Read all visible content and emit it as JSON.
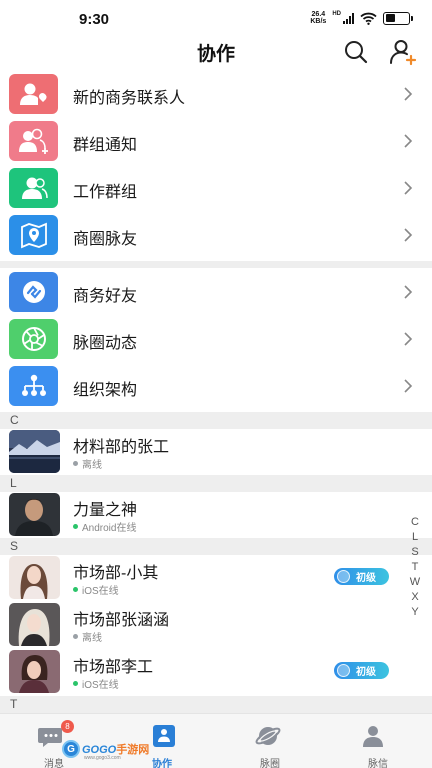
{
  "status_bar": {
    "time": "9:30",
    "net_speed_value": "26.4",
    "net_speed_unit": "KB/s",
    "hd": "HD",
    "battery_level": 0.45
  },
  "nav": {
    "title": "协作",
    "search_icon": "search-icon",
    "add_user_icon": "add-user-icon",
    "accent_plus_color": "#f08a2a"
  },
  "menu_groups": [
    [
      {
        "label": "新的商务联系人",
        "icon": "new-contact-icon",
        "color": "#ee6e73"
      },
      {
        "label": "群组通知",
        "icon": "group-notice-icon",
        "color": "#f07b8a"
      },
      {
        "label": "工作群组",
        "icon": "work-group-icon",
        "color": "#1ec47c"
      },
      {
        "label": "商圈脉友",
        "icon": "location-map-icon",
        "color": "#2b8fe8"
      }
    ],
    [
      {
        "label": "商务好友",
        "icon": "handshake-icon",
        "color": "#3d86e6"
      },
      {
        "label": "脉圈动态",
        "icon": "aperture-icon",
        "color": "#4fcf6c"
      },
      {
        "label": "组织架构",
        "icon": "org-chart-icon",
        "color": "#3b8ff0"
      }
    ]
  ],
  "sections": [
    {
      "letter": "C",
      "contacts": [
        {
          "name": "材料部的张工",
          "status": "离线",
          "status_color": "#9aa0a6",
          "badge": ""
        }
      ]
    },
    {
      "letter": "L",
      "contacts": [
        {
          "name": "力量之神",
          "status": "Android在线",
          "status_color": "#2bc46a",
          "badge": ""
        }
      ]
    },
    {
      "letter": "S",
      "contacts": [
        {
          "name": "市场部-小其",
          "status": "iOS在线",
          "status_color": "#2bc46a",
          "badge": "初级"
        },
        {
          "name": "市场部张涵涵",
          "status": "离线",
          "status_color": "#9aa0a6",
          "badge": ""
        },
        {
          "name": "市场部李工",
          "status": "iOS在线",
          "status_color": "#2bc46a",
          "badge": "初级"
        }
      ]
    },
    {
      "letter": "T",
      "contacts": []
    }
  ],
  "index_letters": [
    "C",
    "L",
    "S",
    "T",
    "W",
    "X",
    "Y"
  ],
  "tabs": [
    {
      "label": "消息",
      "icon": "chat-icon",
      "active": false,
      "unread": "8"
    },
    {
      "label": "协作",
      "icon": "collaboration-icon",
      "active": true,
      "unread": ""
    },
    {
      "label": "脉圈",
      "icon": "planet-icon",
      "active": false,
      "unread": ""
    },
    {
      "label": "脉信",
      "icon": "contact-card-icon",
      "active": false,
      "unread": ""
    }
  ],
  "watermark": {
    "letter": "G",
    "brand": "GOGO",
    "suffix": "手游网",
    "url": "www.gogo3.com"
  },
  "colors": {
    "accent": "#2a7fd6",
    "divider": "#eeeeee",
    "badge_gradient_start": "#2f8fe8",
    "badge_gradient_end": "#3cc3e0"
  }
}
